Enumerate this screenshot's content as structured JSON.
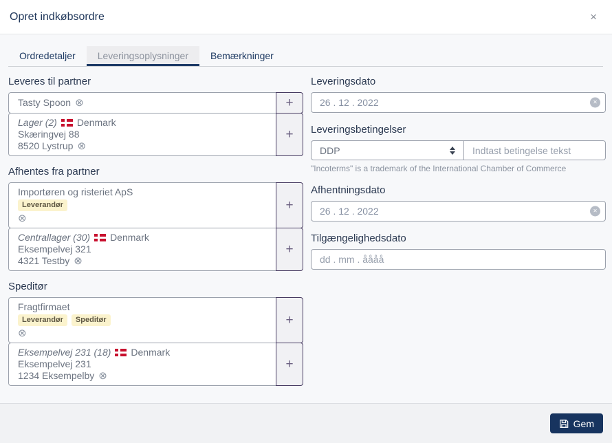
{
  "header": {
    "title": "Opret indkøbsordre"
  },
  "icons": {
    "close": "×",
    "remove": "⊗",
    "plus": "+"
  },
  "tabs": {
    "t0": "Ordredetaljer",
    "t1": "Leveringsoplysninger",
    "t2": "Bemærkninger"
  },
  "left": {
    "section1": {
      "label": "Leveres til partner",
      "row1": {
        "name": "Tasty Spoon"
      },
      "row2": {
        "name": "Lager (2)",
        "country": "Denmark",
        "street": "Skæringvej 88",
        "city": "8520 Lystrup"
      }
    },
    "section2": {
      "label": "Afhentes fra partner",
      "row1": {
        "name": "Importøren og risteriet ApS",
        "badge1": "Leverandør"
      },
      "row2": {
        "name": "Centrallager (30)",
        "country": "Denmark",
        "street": "Eksempelvej 321",
        "city": "4321 Testby"
      }
    },
    "section3": {
      "label": "Speditør",
      "row1": {
        "name": "Fragtfirmaet",
        "badge1": "Leverandør",
        "badge2": "Speditør"
      },
      "row2": {
        "name": "Eksempelvej 231 (18)",
        "country": "Denmark",
        "street": "Eksempelvej 231",
        "city": "1234 Eksempelby"
      }
    }
  },
  "right": {
    "leveringsdato": {
      "label": "Leveringsdato",
      "value": "26 . 12 . 2022"
    },
    "leveringsbetingelser": {
      "label": "Leveringsbetingelser",
      "selected": "DDP",
      "placeholder": "Indtast betingelse tekst",
      "note": "\"Incoterms\" is a trademark of the International Chamber of Commerce"
    },
    "afhentningsdato": {
      "label": "Afhentningsdato",
      "value": "26 . 12 . 2022"
    },
    "tilgaengelighedsdato": {
      "label": "Tilgængelighedsdato",
      "placeholder": "dd . mm . åååå"
    }
  },
  "footer": {
    "save_label": "Gem"
  },
  "colors": {
    "accent": "#17345f",
    "flag_red": "#c8102e",
    "badge_bg": "#fbf3cd",
    "plus_border": "#473b61",
    "tab_underline": "#1d3a66"
  }
}
